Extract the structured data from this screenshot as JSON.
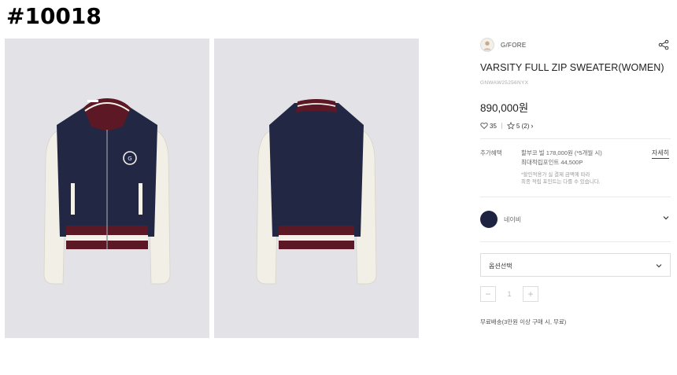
{
  "page_id": "#10018",
  "brand": {
    "name": "G/FORE"
  },
  "product": {
    "title": "VARSITY FULL ZIP SWEATER(WOMEN)",
    "sku": "GNWAW25256NYX",
    "price": "890,000원",
    "likes": "35",
    "rating": "5 (2)"
  },
  "benefit": {
    "label": "추가혜택",
    "line1": "할부코 빌 178,000원 (*5개월 시)",
    "line2": "최대적립포인트 44,500P",
    "note1": "*할인적용가 실 결제 금액에 따라",
    "note2": "최종 적립 포인트는 다를 수 있습니다.",
    "detail_link": "자세히"
  },
  "color": {
    "name": "네이비",
    "hex": "#1d2340"
  },
  "option": {
    "label": "옵션선택"
  },
  "quantity": {
    "minus": "−",
    "value": "1",
    "plus": "+"
  },
  "shipping": "무료배송(3만원 이상 구매 시, 무료)",
  "images": [
    {
      "name": "product-image-front",
      "view": "front"
    },
    {
      "name": "product-image-back",
      "view": "back"
    }
  ]
}
